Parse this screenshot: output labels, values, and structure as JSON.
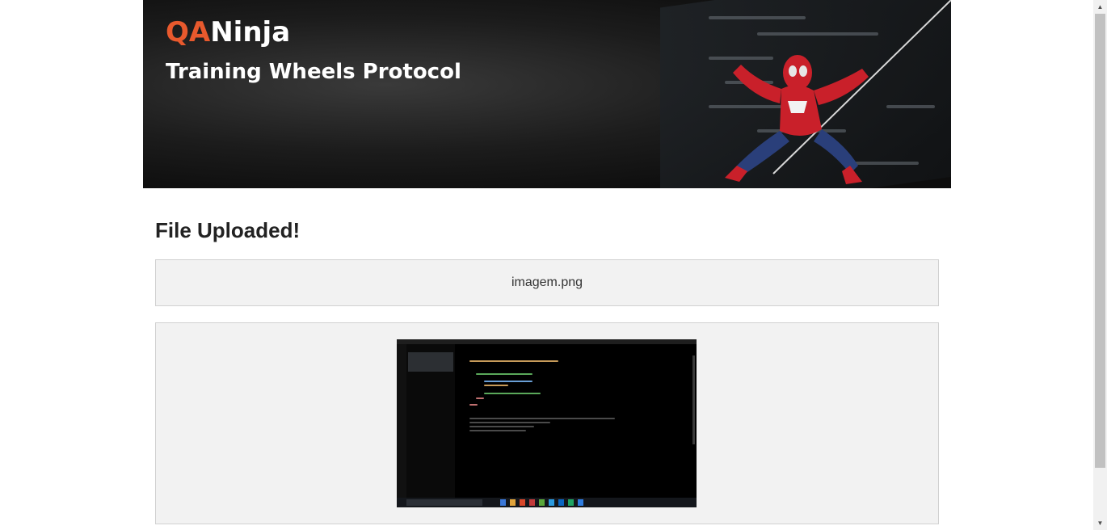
{
  "banner": {
    "logo_prefix": "QA",
    "logo_suffix": "Ninja",
    "title": "Training Wheels Protocol"
  },
  "main": {
    "heading": "File Uploaded!",
    "file_name": "imagem.png"
  },
  "icons": {
    "scroll_up": "scroll-up-arrow-icon",
    "scroll_down": "scroll-down-arrow-icon"
  },
  "colors": {
    "logo_accent": "#e8592d",
    "panel_bg": "#f2f2f2",
    "panel_border": "#d0d0d0"
  }
}
